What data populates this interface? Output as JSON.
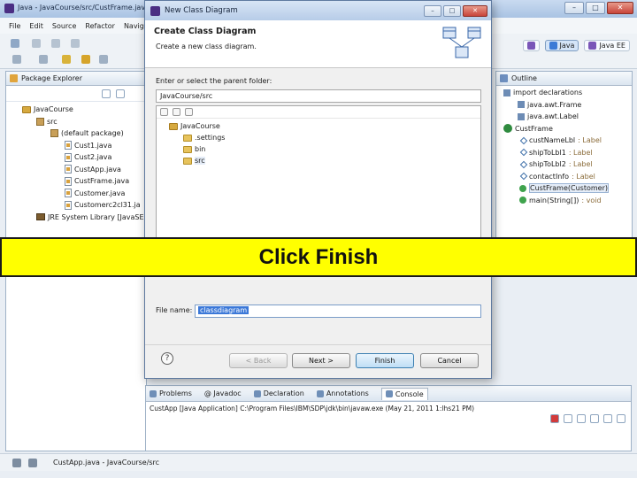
{
  "window": {
    "title": "Java - JavaCourse/src/CustFrame.java"
  },
  "menu": [
    "File",
    "Edit",
    "Source",
    "Refactor",
    "Navig"
  ],
  "perspectives": [
    "Java",
    "Java EE"
  ],
  "package_explorer": {
    "tab": "Package Explorer",
    "items": [
      "JavaCourse",
      "src",
      "(default package)",
      "Cust1.java",
      "Cust2.java",
      "CustApp.java",
      "CustFrame.java",
      "Customer.java",
      "Customerc2cl31.ja",
      "JRE System Library [JavaSE"
    ]
  },
  "outline": {
    "tab": "Outline",
    "items": [
      {
        "label": "import declarations",
        "type": ""
      },
      {
        "label": "java.awt.Frame",
        "type": ""
      },
      {
        "label": "java.awt.Label",
        "type": ""
      },
      {
        "label": "CustFrame",
        "type": ""
      },
      {
        "label": "custNameLbl",
        "type": ": Label"
      },
      {
        "label": "shipToLbl1",
        "type": ": Label"
      },
      {
        "label": "shipToLbl2",
        "type": ": Label"
      },
      {
        "label": "contactInfo",
        "type": ": Label"
      },
      {
        "label": "CustFrame(Customer)",
        "type": ""
      },
      {
        "label": "main(String[])",
        "type": ": void"
      }
    ]
  },
  "bottom": {
    "tabs": [
      "Problems",
      "@ Javadoc",
      "Declaration",
      "Annotations",
      "Console"
    ],
    "console_line": "CustApp [Java Application] C:\\Program Files\\IBM\\SDP\\jdk\\bin\\javaw.exe (May 21, 2011 1:lhs21 PM)"
  },
  "status": {
    "text": "CustApp.java - JavaCourse/src"
  },
  "dialog": {
    "title": "New Class Diagram",
    "header_title": "Create Class Diagram",
    "header_subtitle": "Create a new class diagram.",
    "parent_label": "Enter or select the parent folder:",
    "parent_value": "JavaCourse/src",
    "folders": [
      "JavaCourse",
      ".settings",
      "bin",
      "src"
    ],
    "filename_label": "File name:",
    "filename_value": "classdiagram",
    "buttons": {
      "back": "< Back",
      "next": "Next >",
      "finish": "Finish",
      "cancel": "Cancel"
    },
    "help": "?"
  },
  "callout": {
    "text": "Click Finish",
    "color": "#ffff00"
  }
}
